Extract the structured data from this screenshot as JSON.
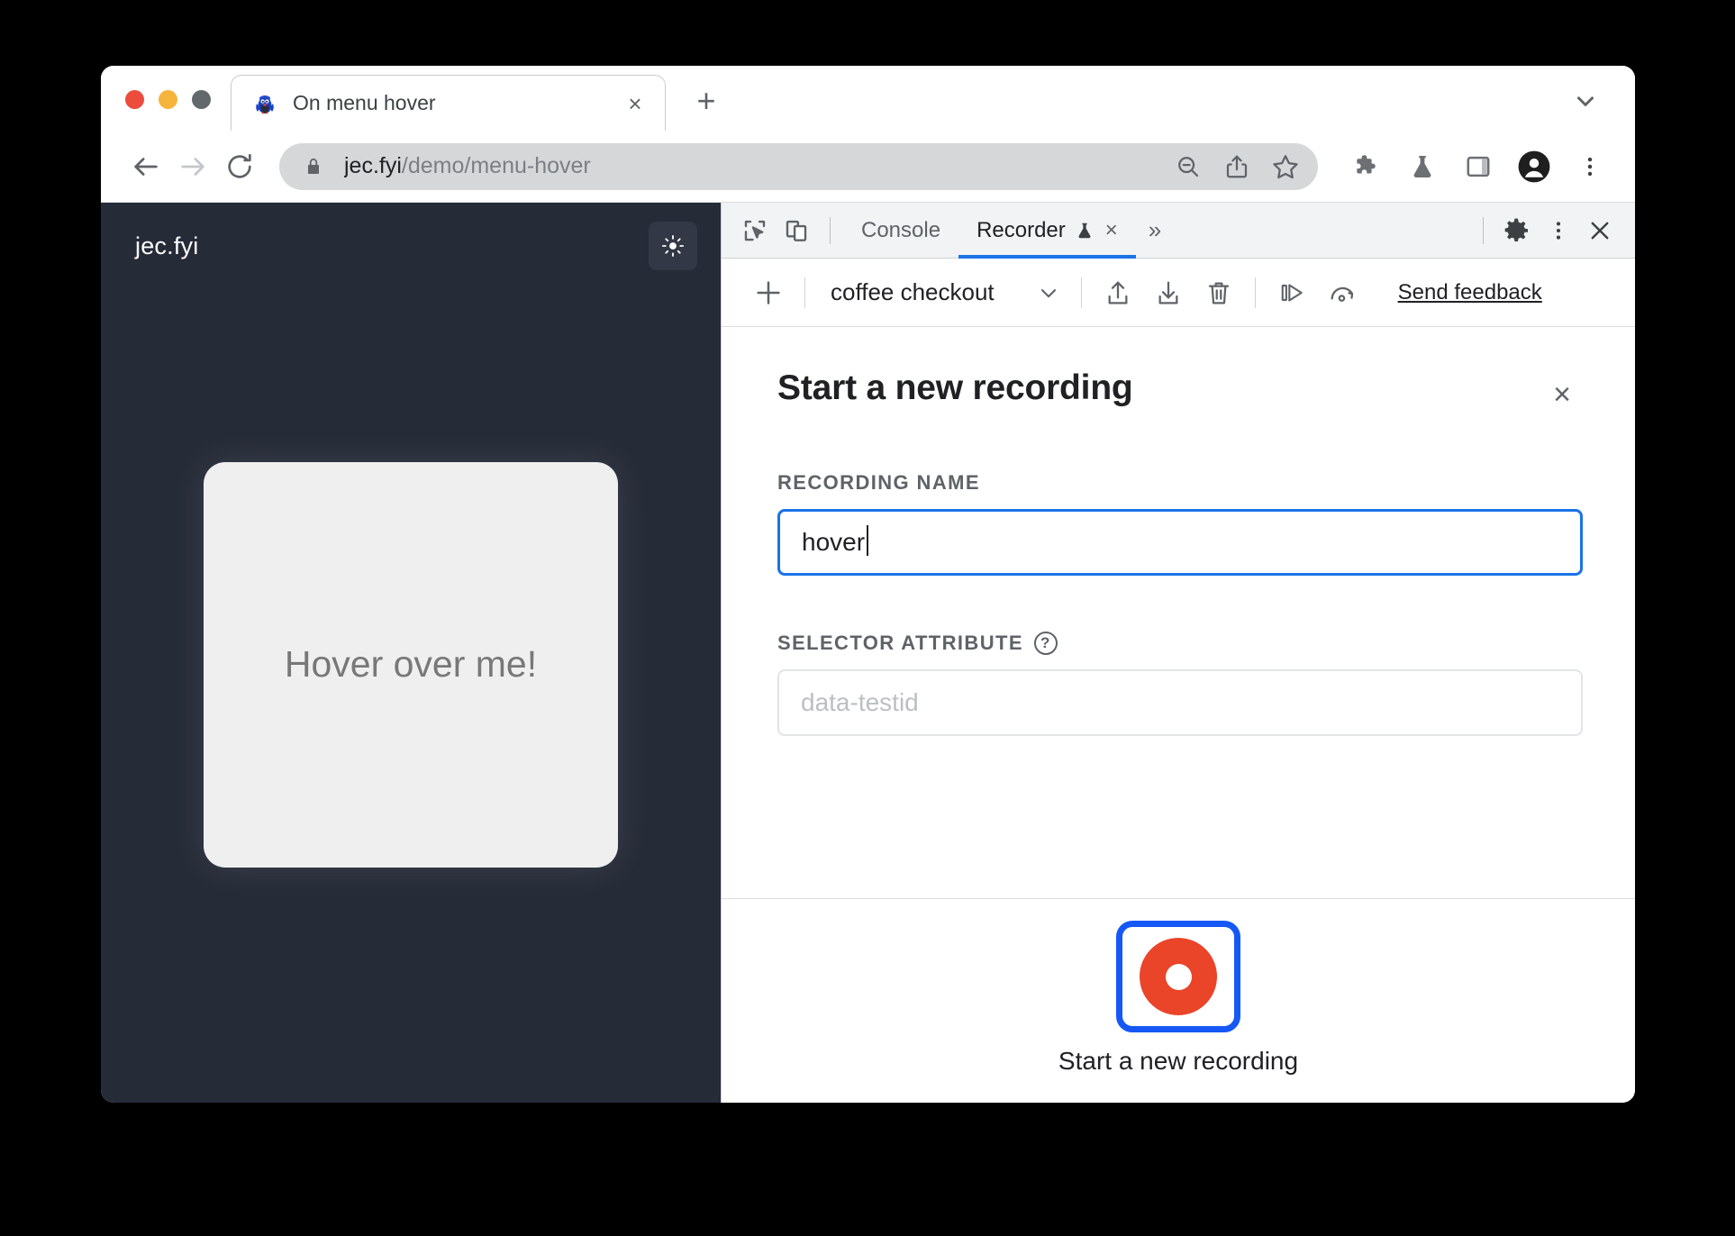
{
  "browser": {
    "traffic_lights": [
      "close",
      "minimize",
      "maximize"
    ],
    "tab": {
      "title": "On menu hover",
      "favicon_name": "penguin-favicon",
      "close_label": "×"
    },
    "new_tab_label": "+",
    "tabstrip_chevron_name": "chevron-down-icon",
    "toolbar": {
      "back_name": "back-arrow-icon",
      "forward_name": "forward-arrow-icon",
      "reload_name": "reload-icon",
      "lock_name": "lock-icon",
      "url_host": "jec.fyi",
      "url_path": "/demo/menu-hover",
      "omnibox_actions": [
        "zoom-out-icon",
        "share-icon",
        "bookmark-star-icon"
      ],
      "toolbar_actions": [
        "extensions-puzzle-icon",
        "flask-icon",
        "side-panel-icon",
        "profile-avatar-icon",
        "three-dot-menu-icon"
      ]
    }
  },
  "page": {
    "logo": "jec.fyi",
    "theme_toggle_name": "sun-icon",
    "card_label": "Hover over me!",
    "background_color": "#262b38",
    "card_color": "#efefef",
    "card_text_color": "#787878"
  },
  "devtools": {
    "tabbar": {
      "inspect_icon_name": "inspect-element-icon",
      "device_icon_name": "device-toolbar-icon",
      "tabs": [
        {
          "label": "Console",
          "active": false,
          "closable": false
        },
        {
          "label": "Recorder",
          "active": true,
          "closable": true,
          "icon": "flask-icon",
          "close_label": "×"
        }
      ],
      "overflow_label": "»",
      "settings_icon_name": "gear-icon",
      "more_icon_name": "three-dot-menu-icon",
      "close_label": "×"
    },
    "recorder_toolbar": {
      "add_label": "+",
      "recording_name": "coffee checkout",
      "dropdown_icon_name": "chevron-down-icon",
      "import_icon_name": "import-upload-icon",
      "export_icon_name": "export-download-icon",
      "delete_icon_name": "trash-icon",
      "replay_icon_name": "step-replay-icon",
      "performance_icon_name": "performance-gauge-icon",
      "feedback_label": "Send feedback"
    },
    "panel": {
      "title": "Start a new recording",
      "close_label": "×",
      "fields": [
        {
          "label": "RECORDING NAME",
          "value": "hover",
          "placeholder": "",
          "focused": true,
          "help": false
        },
        {
          "label": "SELECTOR ATTRIBUTE",
          "value": "",
          "placeholder": "data-testid",
          "focused": false,
          "help": true,
          "help_label": "?"
        }
      ],
      "record_button": {
        "caption": "Start a new recording",
        "outline_color": "#1558f5",
        "donut_color": "#ea4429"
      }
    }
  }
}
